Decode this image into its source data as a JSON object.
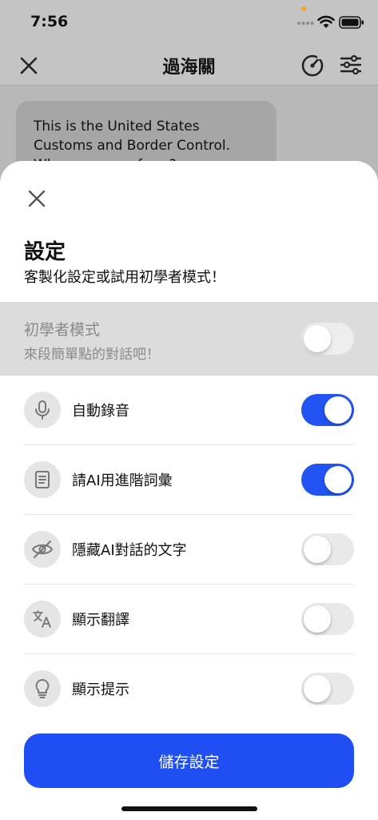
{
  "status_bar": {
    "time": "7:56"
  },
  "nav": {
    "title": "過海關"
  },
  "chat": {
    "message": "This is the United States Customs and Border Control. Where are you from?"
  },
  "sheet": {
    "title": "設定",
    "subtitle": "客製化設定或試用初學者模式！",
    "beginner": {
      "title": "初學者模式",
      "description": "來段簡單點的對話吧！",
      "enabled": false
    },
    "settings": [
      {
        "label": "自動錄音",
        "icon": "microphone-icon",
        "enabled": true
      },
      {
        "label": "請AI用進階詞彙",
        "icon": "document-icon",
        "enabled": true
      },
      {
        "label": "隱藏AI對話的文字",
        "icon": "eye-slash-icon",
        "enabled": false
      },
      {
        "label": "顯示翻譯",
        "icon": "translate-icon",
        "enabled": false
      },
      {
        "label": "顯示提示",
        "icon": "lightbulb-icon",
        "enabled": false
      }
    ],
    "save_label": "儲存設定"
  },
  "colors": {
    "accent": "#2254f4",
    "toggle_off": "#e9e9ea"
  }
}
